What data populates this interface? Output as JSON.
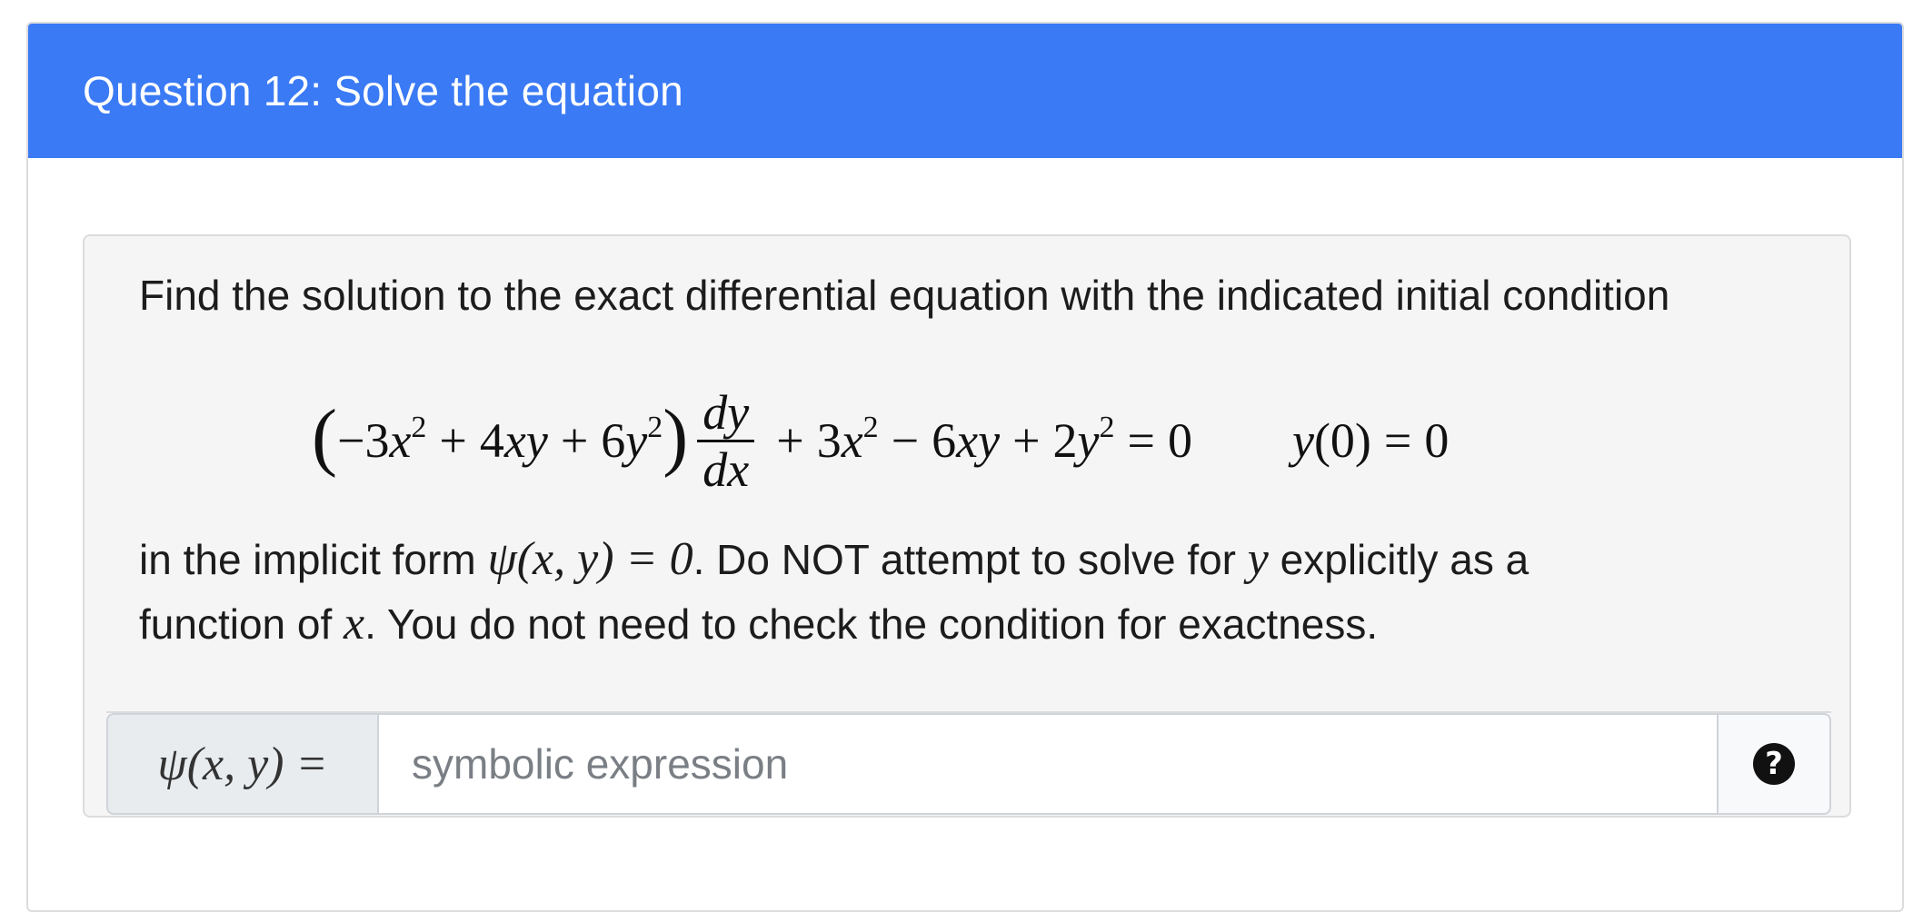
{
  "question": {
    "title": "Question 12: Solve the equation",
    "intro": "Find the solution to the exact differential equation with the indicated initial condition",
    "equation": {
      "coef_group": "−3x² + 4xy + 6y²",
      "frac_num": "dy",
      "frac_den": "dx",
      "rest": "+ 3x² − 6xy + 2y² = 0",
      "initial_condition": "y(0) = 0"
    },
    "body_line1_a": "in the implicit form ",
    "body_line1_math": "ψ(x, y) = 0",
    "body_line1_b": ". Do NOT attempt to solve for ",
    "body_line1_var": "y",
    "body_line1_c": " explicitly as a",
    "body_line2_a": "function of ",
    "body_line2_var": "x",
    "body_line2_b": ". You do not need to check the condition for exactness."
  },
  "answer": {
    "prefix": "ψ(x, y) =",
    "placeholder": "symbolic expression",
    "value": ""
  },
  "icons": {
    "help": "question-circle-icon"
  }
}
